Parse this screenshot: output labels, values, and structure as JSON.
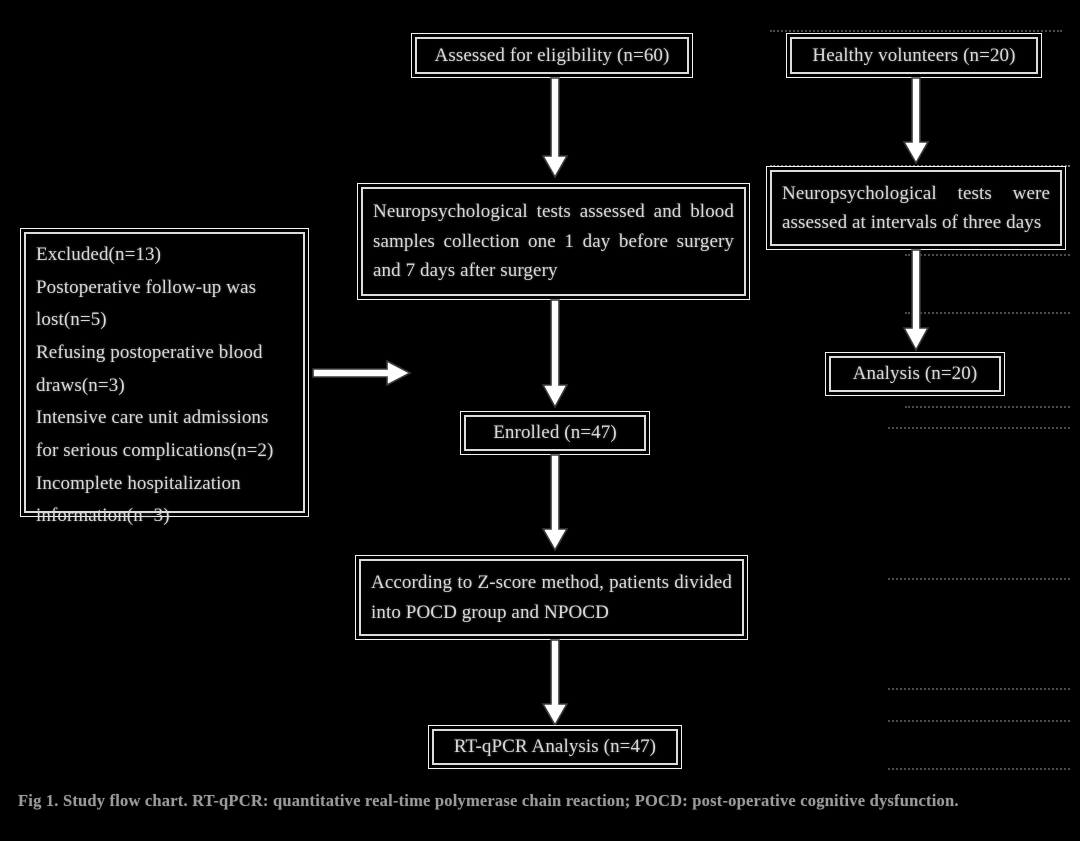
{
  "figure": {
    "caption": "Fig 1. Study flow chart. RT-qPCR: quantitative real-time polymerase chain reaction; POCD: post-operative cognitive dysfunction.",
    "background_color": "#000000",
    "stroke_color": "#f2f2f2",
    "text_color": "#d9d9d9"
  },
  "nodes": {
    "assessed": "Assessed for eligibility (n=60)",
    "healthy_volunteers": "Healthy volunteers (n=20)",
    "neuropsych_patients": "Neuropsychological tests assessed and blood samples collection one 1 day before surgery and 7 days after surgery",
    "neuropsych_volunteers": "Neuropsychological tests were assessed at intervals of three days",
    "excluded": "Excluded(n=13)\nPostoperative follow-up was lost(n=5)\nRefusing postoperative blood draws(n=3)\nIntensive care unit admissions for serious complications(n=2)\nIncomplete hospitalization information(n=3)",
    "enrolled": "Enrolled (n=47)",
    "analysis_volunteers": "Analysis (n=20)",
    "zscore": "According to Z-score method, patients divided into POCD group and NPOCD",
    "rtqpcr": "RT-qPCR Analysis (n=47)"
  },
  "excluded_items": [
    "Excluded(n=13)",
    "Postoperative follow-up was lost(n=5)",
    "Refusing postoperative blood draws(n=3)",
    "Intensive care unit admissions for serious complications(n=2)",
    "Incomplete hospitalization information(n=3)"
  ],
  "counts": {
    "assessed_n": 60,
    "healthy_n": 20,
    "excluded_total_n": 13,
    "excluded_followup_lost_n": 5,
    "excluded_refused_blood_n": 3,
    "excluded_icu_n": 2,
    "excluded_incomplete_info_n": 3,
    "enrolled_n": 47,
    "analysis_volunteers_n": 20,
    "rtqpcr_n": 47
  },
  "arrows": {
    "assessed_to_neuropsych": "down",
    "healthy_to_neuropsych": "down",
    "neuropsych_to_enrolled": "down",
    "neuropsych_volunteers_to_analysis": "down",
    "excluded_to_flow": "right",
    "enrolled_to_zscore": "down",
    "zscore_to_rtqpcr": "down"
  }
}
